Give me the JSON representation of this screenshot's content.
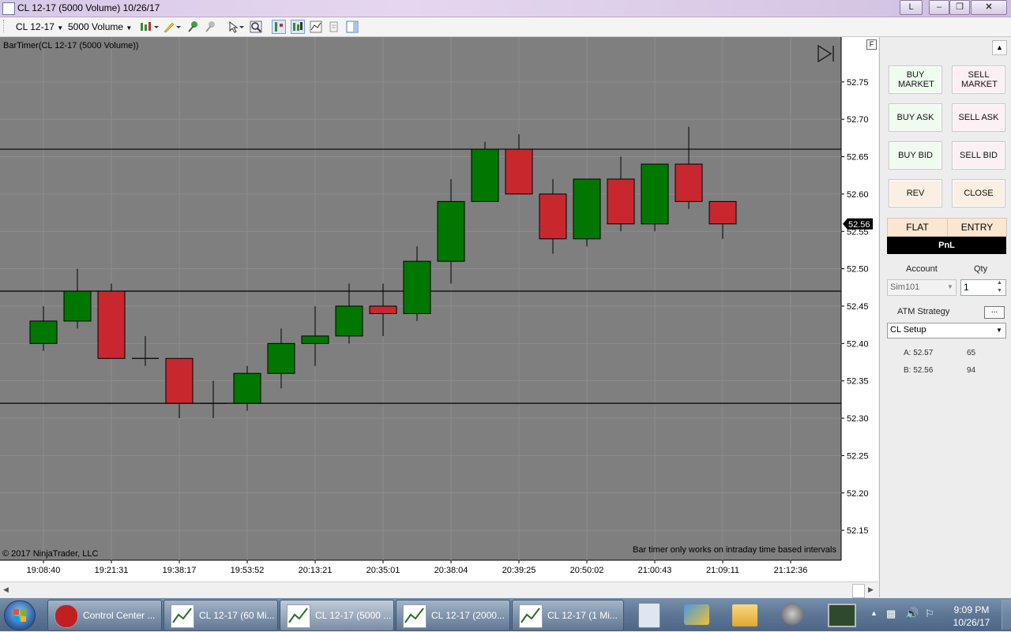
{
  "window": {
    "title": "CL 12-17 (5000 Volume)  10/26/17",
    "link_button": "L"
  },
  "toolbar": {
    "instrument": "CL 12-17",
    "interval": "5000 Volume"
  },
  "chart": {
    "indicator_label": "BarTimer(CL 12-17 (5000 Volume))",
    "copyright": "© 2017 NinjaTrader, LLC",
    "note": "Bar timer only works on intraday time based intervals",
    "last_price": "52.56",
    "f_button": "F"
  },
  "chart_data": {
    "type": "candlestick",
    "x": [
      "19:08:40",
      "19:21:31",
      "19:38:17",
      "19:53:52",
      "20:13:21",
      "20:35:01",
      "20:38:04",
      "20:39:25",
      "20:50:02",
      "21:00:43",
      "21:09:11",
      "21:12:36"
    ],
    "y_ticks": [
      "52.15",
      "52.20",
      "52.25",
      "52.30",
      "52.35",
      "52.40",
      "52.45",
      "52.50",
      "52.55",
      "52.60",
      "52.65",
      "52.70",
      "52.75"
    ],
    "ylim": [
      52.11,
      52.81
    ],
    "horizontal_lines": [
      52.66,
      52.47,
      52.32
    ],
    "candles": [
      {
        "o": 52.4,
        "h": 52.45,
        "l": 52.39,
        "c": 52.43
      },
      {
        "o": 52.43,
        "h": 52.5,
        "l": 52.42,
        "c": 52.47
      },
      {
        "o": 52.47,
        "h": 52.48,
        "l": 52.38,
        "c": 52.38
      },
      {
        "o": 52.38,
        "h": 52.41,
        "l": 52.37,
        "c": 52.38
      },
      {
        "o": 52.38,
        "h": 52.38,
        "l": 52.3,
        "c": 52.32
      },
      {
        "o": 52.32,
        "h": 52.35,
        "l": 52.3,
        "c": 52.32
      },
      {
        "o": 52.32,
        "h": 52.37,
        "l": 52.31,
        "c": 52.36
      },
      {
        "o": 52.36,
        "h": 52.42,
        "l": 52.34,
        "c": 52.4
      },
      {
        "o": 52.4,
        "h": 52.45,
        "l": 52.37,
        "c": 52.41
      },
      {
        "o": 52.41,
        "h": 52.48,
        "l": 52.4,
        "c": 52.45
      },
      {
        "o": 52.45,
        "h": 52.48,
        "l": 52.41,
        "c": 52.44
      },
      {
        "o": 52.44,
        "h": 52.53,
        "l": 52.43,
        "c": 52.51
      },
      {
        "o": 52.51,
        "h": 52.62,
        "l": 52.48,
        "c": 52.59
      },
      {
        "o": 52.59,
        "h": 52.67,
        "l": 52.59,
        "c": 52.66
      },
      {
        "o": 52.66,
        "h": 52.68,
        "l": 52.6,
        "c": 52.6
      },
      {
        "o": 52.6,
        "h": 52.62,
        "l": 52.52,
        "c": 52.54
      },
      {
        "o": 52.54,
        "h": 52.62,
        "l": 52.53,
        "c": 52.62
      },
      {
        "o": 52.62,
        "h": 52.65,
        "l": 52.55,
        "c": 52.56
      },
      {
        "o": 52.56,
        "h": 52.64,
        "l": 52.55,
        "c": 52.64
      },
      {
        "o": 52.64,
        "h": 52.69,
        "l": 52.58,
        "c": 52.59
      },
      {
        "o": 52.59,
        "h": 52.59,
        "l": 52.54,
        "c": 52.56
      }
    ],
    "up_color": "#007800",
    "down_color": "#c8282d",
    "background": "#7f7f7f"
  },
  "panel": {
    "buy_market": "BUY MARKET",
    "sell_market": "SELL MARKET",
    "buy_ask": "BUY ASK",
    "sell_ask": "SELL ASK",
    "buy_bid": "BUY BID",
    "sell_bid": "SELL BID",
    "rev": "REV",
    "close": "CLOSE",
    "position": "FLAT",
    "entry": "ENTRY",
    "pnl": "PnL",
    "account_label": "Account",
    "qty_label": "Qty",
    "account_value": "Sim101",
    "qty_value": "1",
    "atm_label": "ATM Strategy",
    "atm_button": "...",
    "atm_value": "CL Setup",
    "ask_label": "A: 52.57",
    "ask_size": "65",
    "bid_label": "B: 52.56",
    "bid_size": "94"
  },
  "taskbar": {
    "items": [
      {
        "label": "Control Center ..."
      },
      {
        "label": "CL 12-17 (60 Mi..."
      },
      {
        "label": "CL 12-17 (5000 ..."
      },
      {
        "label": "CL 12-17 (2000..."
      },
      {
        "label": "CL 12-17 (1 Mi..."
      }
    ],
    "time": "9:09 PM",
    "date": "10/26/17"
  }
}
